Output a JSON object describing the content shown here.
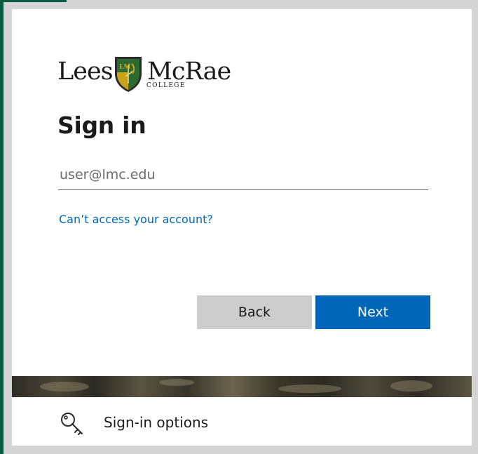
{
  "brand": {
    "logo_word_left": "Lees",
    "logo_word_right": "McRae",
    "logo_subtext": "COLLEGE",
    "logo_shield_letters": "LM"
  },
  "signin": {
    "title": "Sign in",
    "email_placeholder": "user@lmc.edu",
    "email_value": "",
    "cant_access_link": "Can’t access your account?",
    "back_label": "Back",
    "next_label": "Next"
  },
  "footer": {
    "signin_options_label": "Sign-in options",
    "signin_options_icon": "key-icon"
  },
  "colors": {
    "accent": "#0067b8",
    "back_button": "#cccccc",
    "page_background": "#d4d4d4",
    "edge_green": "#0b5a44",
    "shield_gold": "#c8a317",
    "shield_green": "#2d6a33"
  }
}
